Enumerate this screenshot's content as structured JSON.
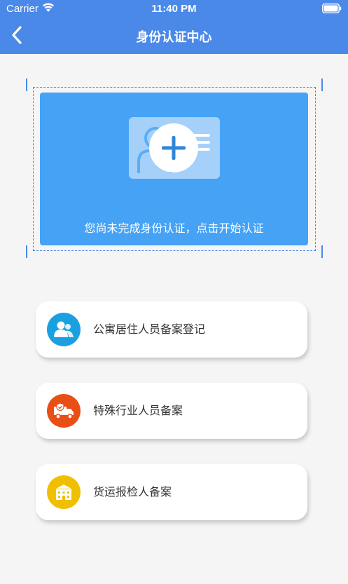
{
  "status_bar": {
    "carrier": "Carrier",
    "time": "11:40 PM",
    "wifi_icon": "wifi-icon",
    "battery_icon": "battery-icon"
  },
  "nav": {
    "title": "身份认证中心",
    "back_icon": "chevron-left-icon"
  },
  "id_card": {
    "prompt": "您尚未完成身份认证，点击开始认证",
    "icon": "add-id-card-icon"
  },
  "menu": [
    {
      "label": "公寓居住人员备案登记",
      "icon": "residents-icon",
      "color": "#1aa0e0"
    },
    {
      "label": "特殊行业人员备案",
      "icon": "delivery-truck-icon",
      "color": "#e84f17"
    },
    {
      "label": "货运报检人备案",
      "icon": "building-icon",
      "color": "#f0c000"
    }
  ],
  "colors": {
    "header": "#4a89e8",
    "card": "#45a2f5",
    "background": "#f5f5f5"
  }
}
